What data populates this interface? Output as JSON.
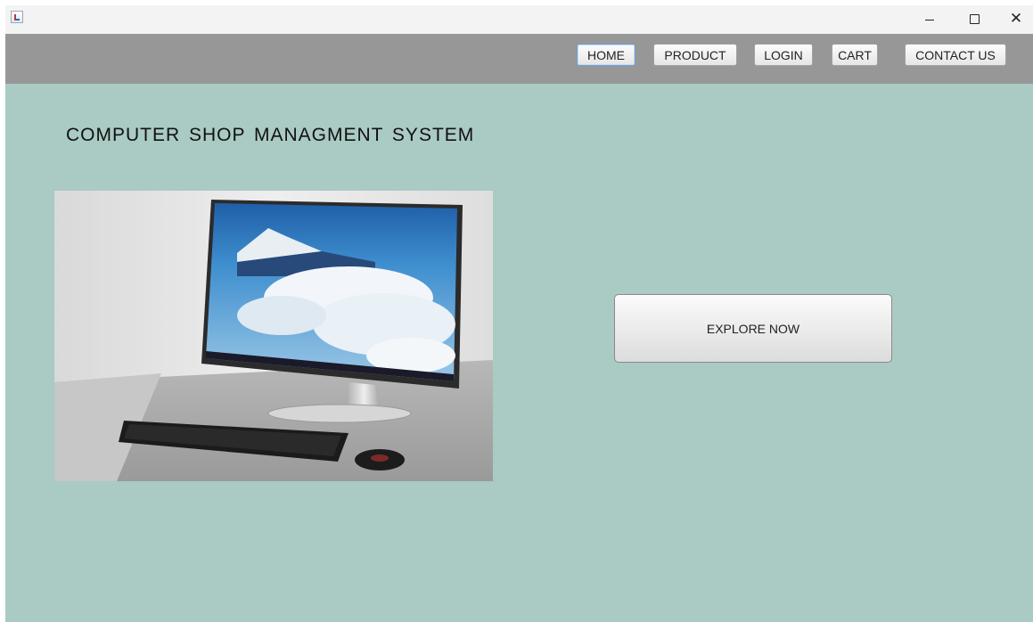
{
  "window": {
    "app_icon": "java-cup-icon",
    "controls": {
      "minimize_icon": "minimize-icon",
      "maximize_icon": "maximize-icon",
      "close_icon": "close-icon",
      "close_glyph": "✕"
    }
  },
  "nav": {
    "background": "#979797",
    "items": [
      {
        "label": "HOME",
        "active": true
      },
      {
        "label": "PRODUCT",
        "active": false
      },
      {
        "label": "LOGIN",
        "active": false
      },
      {
        "label": "CART",
        "active": false
      },
      {
        "label": "CONTACT US",
        "active": false
      }
    ]
  },
  "main": {
    "background": "#aacac4",
    "title": "COMPUTER SHOP MANAGMENT SYSTEM",
    "hero_image": "desktop-computer-photo",
    "explore_button": "EXPLORE NOW"
  }
}
